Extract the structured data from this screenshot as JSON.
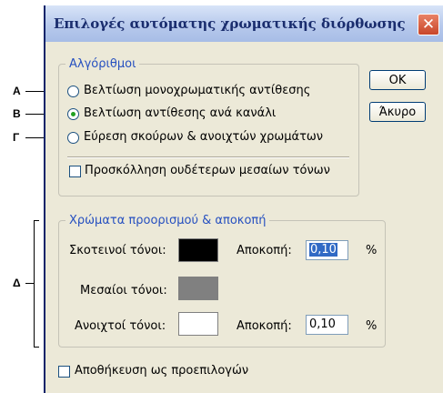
{
  "window": {
    "title": "Επιλογές αυτόματης χρωματικής διόρθωσης",
    "close_glyph": "✕"
  },
  "callouts": {
    "a": "A",
    "b": "B",
    "g": "Γ",
    "d": "Δ"
  },
  "algorithms": {
    "legend": "Αλγόριθμοι",
    "options": [
      {
        "label": "Βελτίωση μονοχρωματικής αντίθεσης",
        "selected": false
      },
      {
        "label": "Βελτίωση αντίθεσης ανά κανάλι",
        "selected": true
      },
      {
        "label": "Εύρεση σκούρων & ανοιχτών χρωμάτων",
        "selected": false
      }
    ],
    "snap_neutral": {
      "label": "Προσκόλληση ουδέτερων μεσαίων τόνων",
      "checked": false
    }
  },
  "buttons": {
    "ok": "OK",
    "cancel": "Άκυρο"
  },
  "targets": {
    "legend": "Χρώματα προορισμού & αποκοπή",
    "shadows": {
      "label": "Σκοτεινοί τόνοι:",
      "color": "#000000"
    },
    "midtones": {
      "label": "Μεσαίοι τόνοι:",
      "color": "#808080"
    },
    "highlights": {
      "label": "Ανοιχτοί τόνοι:",
      "color": "#ffffff"
    },
    "clip_label": "Αποκοπή:",
    "shadow_clip": "0,10",
    "highlight_clip": "0,10",
    "percent": "%"
  },
  "save_defaults": {
    "label": "Αποθήκευση ως προεπιλογών",
    "checked": false
  }
}
